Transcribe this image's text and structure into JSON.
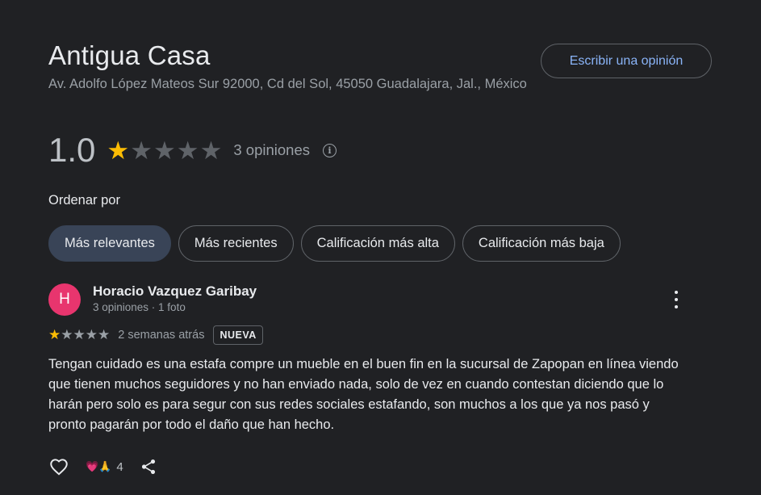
{
  "place": {
    "name": "Antigua Casa",
    "address": "Av. Adolfo López Mateos Sur 92000, Cd del Sol, 45050 Guadalajara, Jal., México"
  },
  "write_review_label": "Escribir una opinión",
  "summary": {
    "rating": "1.0",
    "stars_filled": 1,
    "stars_total": 5,
    "review_count": "3 opiniones",
    "info_icon": "info-icon"
  },
  "sort": {
    "label": "Ordenar por",
    "options": [
      {
        "label": "Más relevantes",
        "selected": true
      },
      {
        "label": "Más recientes",
        "selected": false
      },
      {
        "label": "Calificación más alta",
        "selected": false
      },
      {
        "label": "Calificación más baja",
        "selected": false
      }
    ]
  },
  "review": {
    "avatar_initial": "H",
    "avatar_color": "#e8356e",
    "author": "Horacio Vazquez Garibay",
    "meta": "3 opiniones · 1 foto",
    "stars_filled": 1,
    "stars_total": 5,
    "time": "2 semanas atrás",
    "badge": "NUEVA",
    "text": "Tengan cuidado es una estafa compre un mueble en el buen fin en la sucursal de Zapopan en línea viendo que tienen muchos seguidores y no han enviado nada, solo de vez en cuando contestan diciendo que lo harán pero solo es para segur con sus redes sociales estafando, son muchos a los que ya nos pasó y pronto pagarán por todo el daño que han hecho.",
    "reactions": {
      "emojis": [
        "💗",
        "🙏"
      ],
      "count": "4"
    }
  },
  "colors": {
    "background": "#202124",
    "accent_link": "#8ab4f8",
    "star": "#fbbc04",
    "chip_selected": "#394457"
  }
}
